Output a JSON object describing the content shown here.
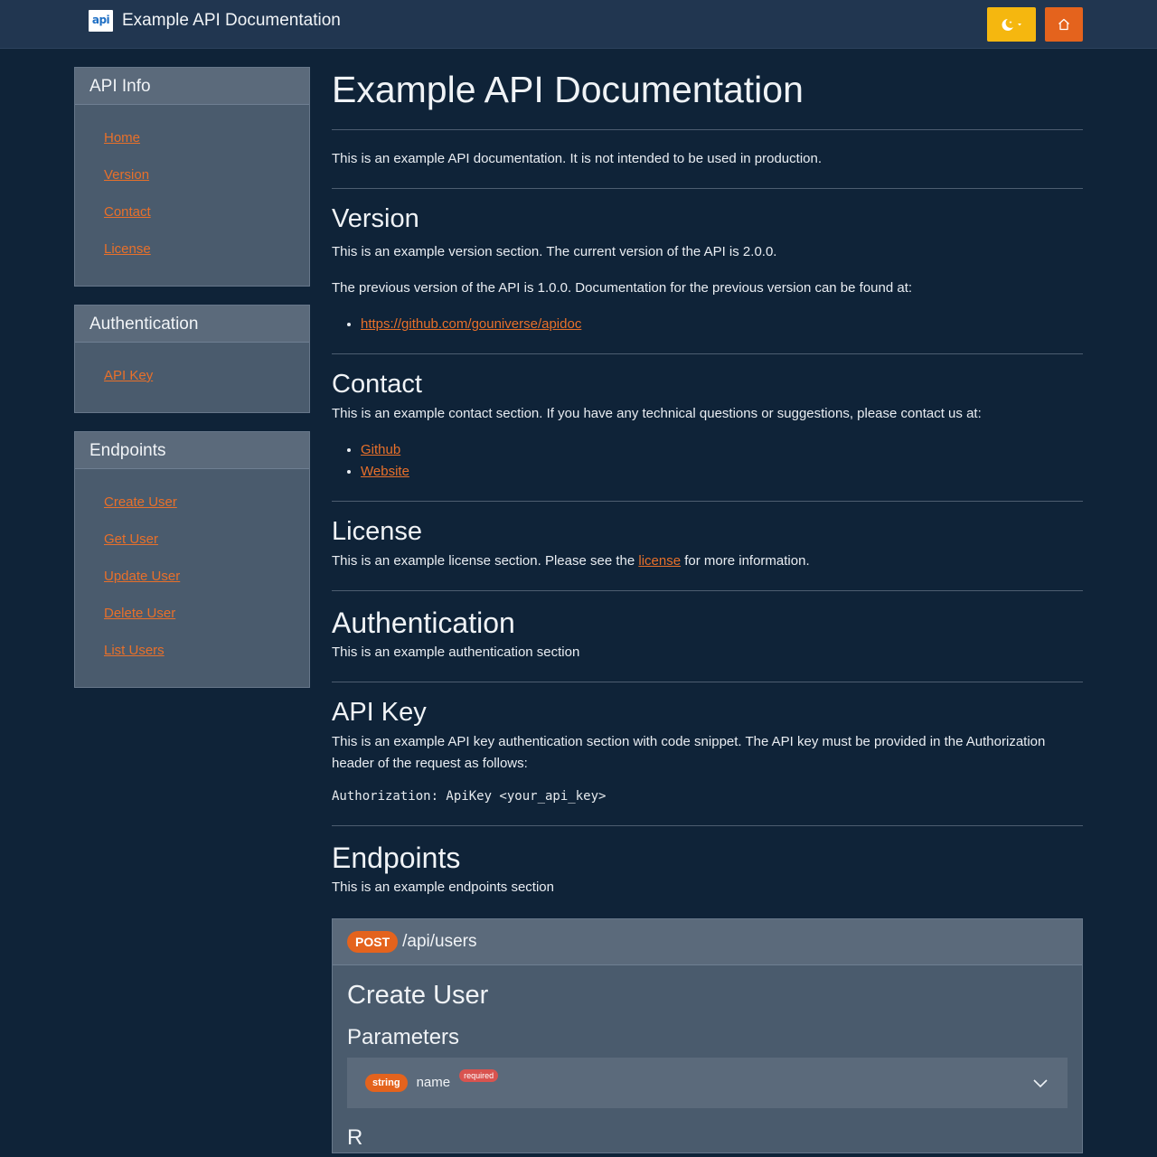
{
  "navbar": {
    "logo_text": "api",
    "title": "Example API Documentation",
    "theme_icon": "moon-icon",
    "home_icon": "home-icon",
    "colors": {
      "background": "#213650",
      "theme_button": "#f5b70f",
      "home_button": "#e4631d"
    }
  },
  "sidebar": {
    "api_info": {
      "title": "API Info",
      "items": [
        "Home",
        "Version",
        "Contact",
        "License"
      ]
    },
    "authentication": {
      "title": "Authentication",
      "items": [
        "API Key"
      ]
    },
    "endpoints": {
      "title": "Endpoints",
      "items": [
        "Create User",
        "Get User",
        "Update User",
        "Delete User",
        "List Users"
      ]
    }
  },
  "main": {
    "title": "Example API Documentation",
    "intro": "This is an example API documentation. It is not intended to be used in production.",
    "version": {
      "heading": "Version",
      "p1": "This is an example version section. The current version of the API is 2.0.0.",
      "p2": "The previous version of the API is 1.0.0. Documentation for the previous version can be found at:",
      "link": "https://github.com/gouniverse/apidoc"
    },
    "contact": {
      "heading": "Contact",
      "p1": "This is an example contact section. If you have any technical questions or suggestions, please contact us at:",
      "links": [
        "Github",
        "Website"
      ]
    },
    "license": {
      "heading": "License",
      "before": "This is an example license section. Please see the ",
      "link": "license",
      "after": " for more information."
    },
    "authentication": {
      "heading": "Authentication",
      "p1": "This is an example authentication section"
    },
    "api_key": {
      "heading": "API Key",
      "p1": "This is an example API key authentication section with code snippet. The API key must be provided in the Authorization header of the request as follows:",
      "code": "Authorization: ApiKey <your_api_key>"
    },
    "endpoints": {
      "heading": "Endpoints",
      "p1": "This is an example endpoints section",
      "card": {
        "method": "POST",
        "path": "/api/users",
        "title": "Create User",
        "parameters_heading": "Parameters",
        "param": {
          "type": "string",
          "name": "name",
          "required": "required"
        },
        "next_heading": "R"
      }
    }
  },
  "colors": {
    "page_bg": "#0f2338",
    "accent": "#e8702a",
    "card_bg": "#4a5b6d"
  }
}
